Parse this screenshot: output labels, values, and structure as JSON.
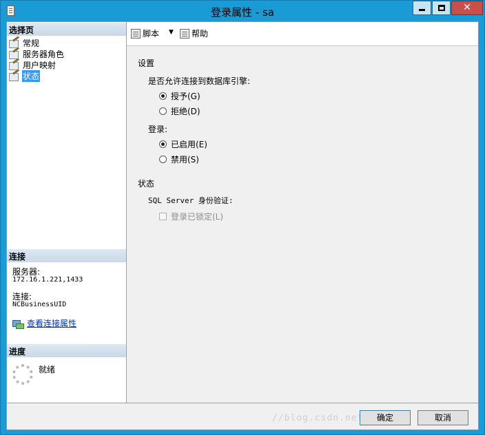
{
  "window": {
    "title": "登录属性 - sa",
    "minimize_glyph": "",
    "close_glyph": "✕"
  },
  "left": {
    "pages_header": "选择页",
    "pages": [
      {
        "label": "常规"
      },
      {
        "label": "服务器角色"
      },
      {
        "label": "用户映射"
      },
      {
        "label": "状态"
      }
    ],
    "connection_header": "连接",
    "server_label": "服务器:",
    "server_value": "172.16.1.221,1433",
    "conn_label": "连接:",
    "conn_value": "NCBusinessUID",
    "view_conn_link": "查看连接属性",
    "progress_header": "进度",
    "progress_status": "就绪"
  },
  "toolbar": {
    "script_label": "脚本",
    "dropdown_glyph": "▼",
    "help_label": "帮助"
  },
  "settings": {
    "group_title": "设置",
    "engine_question": "是否允许连接到数据库引擎:",
    "grant_label": "授予(G)",
    "deny_label": "拒绝(D)",
    "login_label": "登录:",
    "enabled_label": "已启用(E)",
    "disabled_label": "禁用(S)"
  },
  "status": {
    "group_title": "状态",
    "auth_label": "SQL Server 身份验证:",
    "locked_label": "登录已锁定(L)"
  },
  "buttons": {
    "ok": "确定",
    "cancel": "取消"
  },
  "watermark": "//blog.csdn.net/..."
}
